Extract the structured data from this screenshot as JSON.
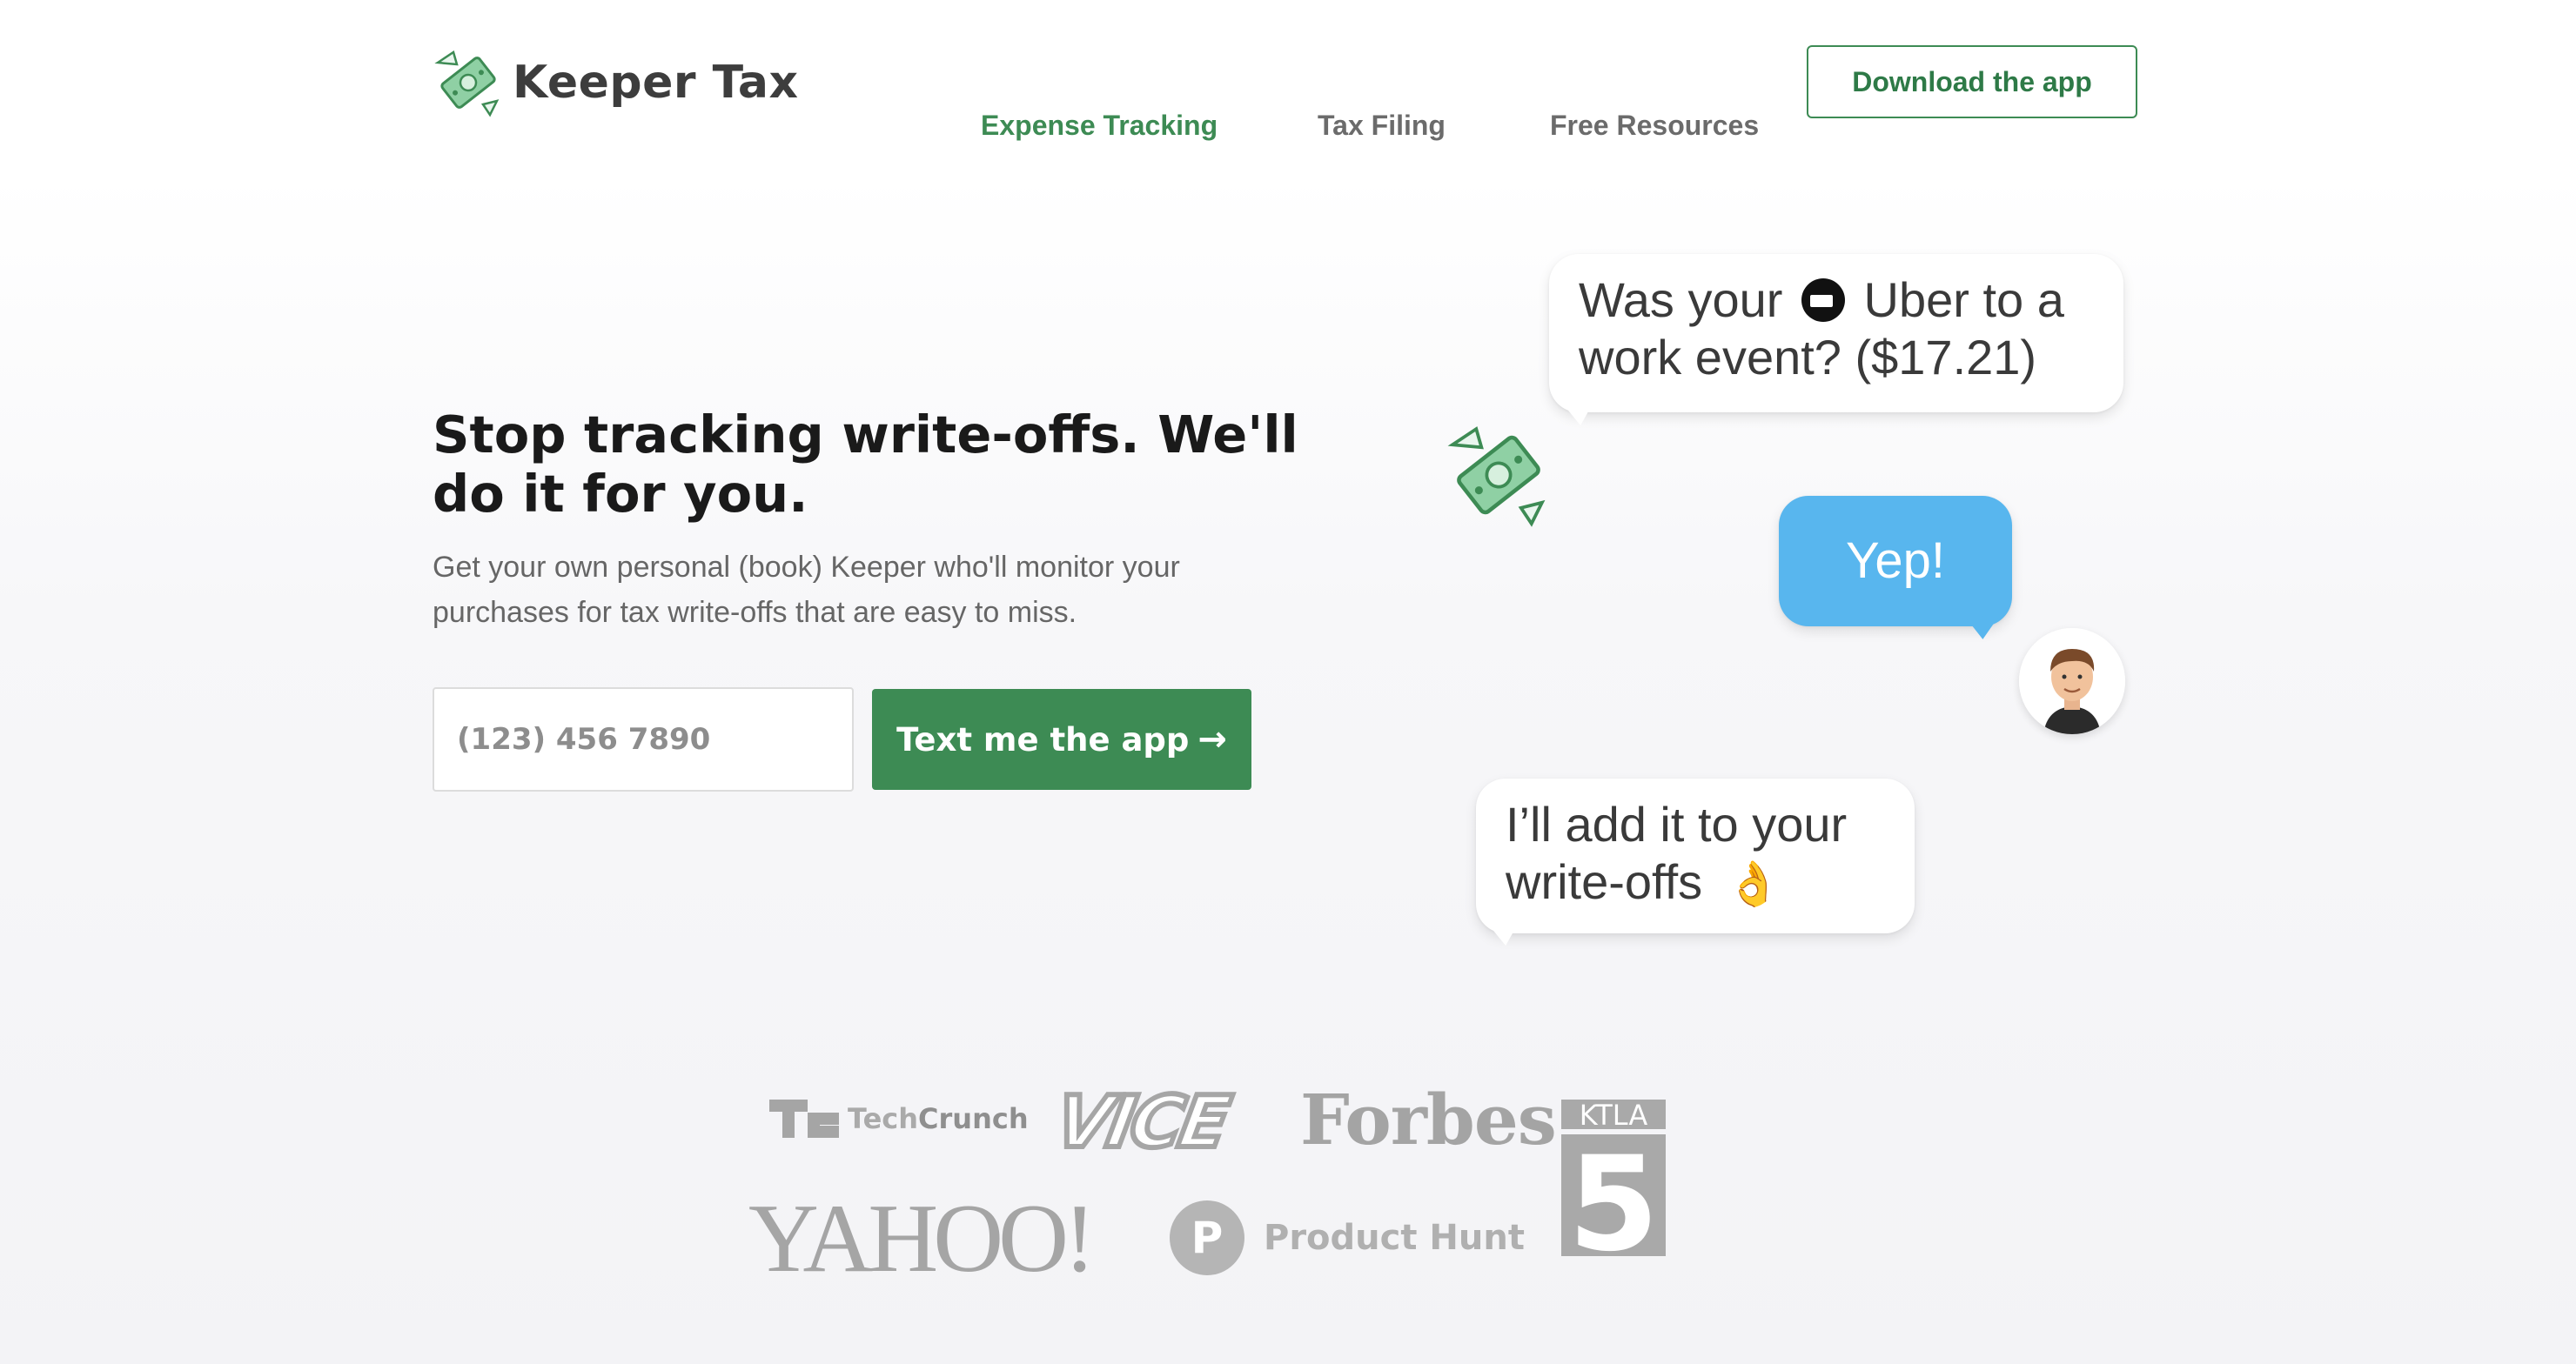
{
  "brand": {
    "name": "Keeper Tax",
    "accent": "#3d8b54"
  },
  "nav": {
    "items": [
      "Expense Tracking",
      "Tax Filing",
      "Free Resources"
    ],
    "active": "Expense Tracking",
    "cta": "Download the app"
  },
  "hero": {
    "headline": "Stop tracking write-offs. We'll do it for you.",
    "subtext": "Get your own personal (book) Keeper who'll monitor your purchases for tax write-offs that are easy to miss.",
    "phone_placeholder": "(123) 456 7890",
    "button_label": "Text me the app",
    "button_arrow": "→"
  },
  "chat": {
    "msg1_before": "Was your",
    "msg1_after": "Uber to a work event? ($17.21)",
    "msg2": "Yep!",
    "msg3": "I’ll add it to your write-offs",
    "msg3_emoji": "👌",
    "user_bubble_color": "#58b6ee"
  },
  "press": {
    "techcrunch_prefix": "Tech",
    "techcrunch_suffix": "Crunch",
    "vice": "VICE",
    "forbes": "Forbes",
    "ktla": "KTLA",
    "ktla_number": "5",
    "yahoo": "YAHOO!",
    "producthunt_letter": "P",
    "producthunt": "Product Hunt"
  },
  "icons": {
    "logo": "flying-money-icon",
    "uber": "uber-icon",
    "ok": "ok-hand-icon",
    "avatar": "user-avatar"
  }
}
